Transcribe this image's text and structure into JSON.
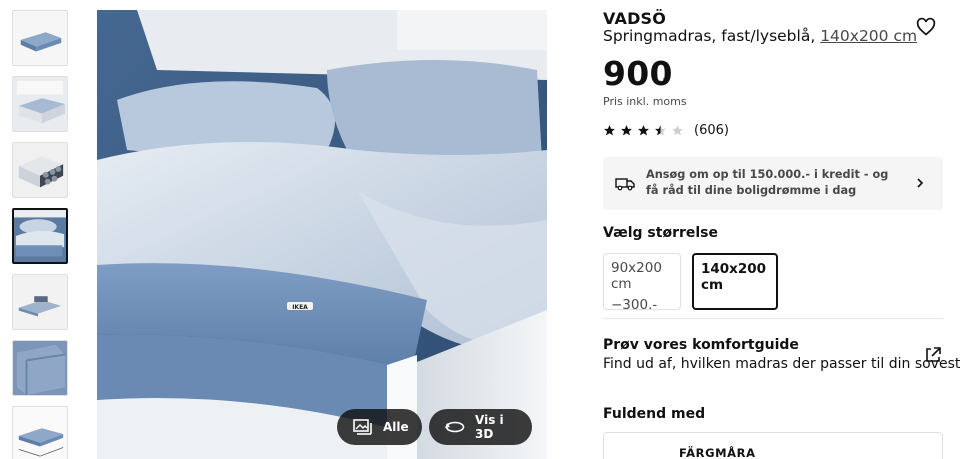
{
  "gallery": {
    "thumbnails": [
      {
        "icon": "mattress-angle-thumb",
        "active": false
      },
      {
        "icon": "bed-frame-thumb",
        "active": false
      },
      {
        "icon": "springs-cross-section-thumb",
        "active": false
      },
      {
        "icon": "bed-closeup-thumb",
        "active": true
      },
      {
        "icon": "rolled-mattress-thumb",
        "active": false
      },
      {
        "icon": "mattress-corner-thumb",
        "active": false
      },
      {
        "icon": "mattress-dimensions-thumb",
        "active": false
      }
    ],
    "main_image_logo": "IKEA",
    "buttons": {
      "all_label": "Alle",
      "view3d_label": "Vis i 3D"
    }
  },
  "product": {
    "brand": "VADSÖ",
    "description_prefix": "Springmadras, fast/lyseblå, ",
    "description_size": "140x200 cm",
    "price": "900",
    "price_suffix": ".-",
    "price_note": "Pris inkl. moms",
    "rating_stars": 3.5,
    "rating_count": "(606)"
  },
  "credit": {
    "text": "Ansøg om op til 150.000.- i kredit - og få råd til dine boligdrømme i dag"
  },
  "size": {
    "label": "Vælg størrelse",
    "options": [
      {
        "label": "90x200 cm",
        "price": "−300.-",
        "selected": false
      },
      {
        "label": "140x200 cm",
        "price": "",
        "selected": true
      }
    ]
  },
  "comfort": {
    "title": "Prøv vores komfortguide",
    "subtitle": "Find ud af, hvilken madras der passer til din sovestil"
  },
  "complete_with": {
    "title": "Fuldend med",
    "item_name": "FÄRGMÅRA"
  },
  "colors": {
    "mattress_blue": "#6f8fb8",
    "dark_button": "#111111",
    "text_grey": "#484848"
  }
}
